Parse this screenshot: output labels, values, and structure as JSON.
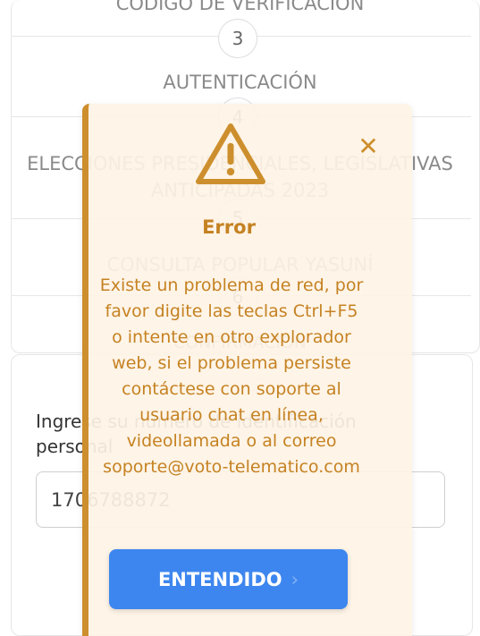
{
  "steps": [
    {
      "title": "CÓDIGO DE VERIFICACIÓN",
      "number": "3"
    },
    {
      "title": "AUTENTICACIÓN",
      "number": "4"
    },
    {
      "title": "ELECCIONES PRESIDENCIALES, LEGISLATIVAS ANTICIPADAS 2023",
      "number": "5"
    },
    {
      "title": "CONSULTA POPULAR YASUNÍ",
      "number": "6"
    },
    {
      "title": "CONFIRMACIÓN",
      "number": ""
    }
  ],
  "identification": {
    "label": "Ingrese su número de identificación personal",
    "value": "1706788872"
  },
  "modal": {
    "title": "Error",
    "message": "Existe un problema de red, por favor digite las teclas Ctrl+F5 o intente en otro explorador web, si el problema persiste contáctese con soporte al usuario chat en línea, videollamada o al correo soporte@voto-telematico.com",
    "close_symbol": "✕",
    "button_label": "ENTENDIDO",
    "button_chevron": "›",
    "accent_color": "#cd8f2d",
    "button_color": "#3d86ef"
  }
}
